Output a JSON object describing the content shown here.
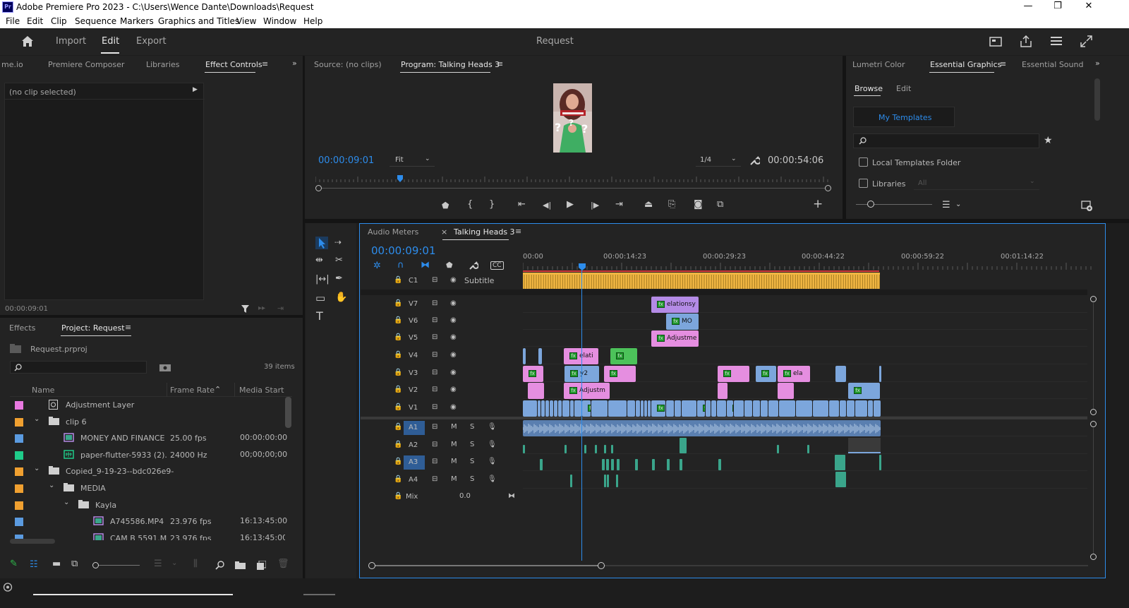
{
  "window": {
    "app_badge": "Pr",
    "title": "Adobe Premiere Pro 2023 - C:\\Users\\Wence Dante\\Downloads\\Request",
    "minimize": "—",
    "restore": "❐",
    "close": "✕"
  },
  "menu": [
    "File",
    "Edit",
    "Clip",
    "Sequence",
    "Markers",
    "Graphics and Titles",
    "View",
    "Window",
    "Help"
  ],
  "header": {
    "nav": [
      "Import",
      "Edit",
      "Export"
    ],
    "active": "Edit",
    "project_name": "Request"
  },
  "left_top": {
    "tabs": [
      "me.io",
      "Premiere Composer",
      "Libraries",
      "Effect Controls"
    ],
    "active_tab": "Effect Controls",
    "no_clip": "(no clip selected)",
    "timecode": "00:00:09:01"
  },
  "project": {
    "tabs": [
      "Effects",
      "Project: Request"
    ],
    "active_tab": "Project: Request",
    "file": "Request.prproj",
    "item_count": "39 items",
    "columns": [
      "Name",
      "Frame Rate",
      "Media Start"
    ],
    "rows": [
      {
        "name": "Adjustment Layer",
        "color": "#e879e0",
        "indent": 0,
        "type": "adjust",
        "frame_rate": "",
        "media_start": ""
      },
      {
        "name": "clip 6",
        "color": "#f0a030",
        "indent": 0,
        "type": "folder",
        "frame_rate": "",
        "media_start": ""
      },
      {
        "name": "MONEY AND FINANCE",
        "color": "#5b9be0",
        "indent": 1,
        "type": "sequence",
        "frame_rate": "25.00 fps",
        "media_start": "00:00:00:00"
      },
      {
        "name": "paper-flutter-5933 (2).",
        "color": "#1fcc8a",
        "indent": 1,
        "type": "audio",
        "frame_rate": "24000 Hz",
        "media_start": "00;00;00;00"
      },
      {
        "name": "Copied_9-19-23--bdc026e9-",
        "color": "#f0a030",
        "indent": 0,
        "type": "folder",
        "frame_rate": "",
        "media_start": ""
      },
      {
        "name": "MEDIA",
        "color": "#f0a030",
        "indent": 1,
        "type": "folder",
        "frame_rate": "",
        "media_start": ""
      },
      {
        "name": "Kayla",
        "color": "#f0a030",
        "indent": 2,
        "type": "folder",
        "frame_rate": "",
        "media_start": ""
      },
      {
        "name": "A745586.MP4",
        "color": "#5b9be0",
        "indent": 3,
        "type": "video",
        "frame_rate": "23.976 fps",
        "media_start": "16:13:45:00"
      },
      {
        "name": "CAM B 5591.M",
        "color": "#5b9be0",
        "indent": 3,
        "type": "video",
        "frame_rate": "23.976 fps",
        "media_start": "16:13:45:00"
      }
    ]
  },
  "monitor": {
    "tabs": [
      "Source: (no clips)",
      "Program: Talking Heads 3"
    ],
    "active_tab": "Program: Talking Heads 3",
    "timecode": "00:00:09:01",
    "fit": "Fit",
    "resolution": "1/4",
    "duration": "00:00:54:06",
    "playhead_pct": 0.255
  },
  "essential_graphics": {
    "tabs": [
      "Lumetri Color",
      "Essential Graphics",
      "Essential Sound"
    ],
    "active_tab": "Essential Graphics",
    "subtabs": [
      "Browse",
      "Edit"
    ],
    "active_subtab": "Browse",
    "templates_button": "My Templates",
    "local_templates": "Local Templates Folder",
    "libraries": "Libraries",
    "libraries_select": "All"
  },
  "timeline": {
    "tabs": [
      "Audio Meters",
      "Talking Heads 3"
    ],
    "active_tab": "Talking Heads 3",
    "timecode": "00:00:09:01",
    "ruler": [
      "00:00",
      "00:00:14:23",
      "00:00:29:23",
      "00:00:44:22",
      "00:00:59:22",
      "00:01:14:22"
    ],
    "caption_track": {
      "name": "C1",
      "label": "Subtitle"
    },
    "video_tracks": [
      "V7",
      "V6",
      "V5",
      "V4",
      "V3",
      "V2",
      "V1"
    ],
    "audio_tracks": [
      "A1",
      "A2",
      "A3",
      "A4"
    ],
    "highlighted_audio": [
      "A1",
      "A3"
    ],
    "mute_label": "M",
    "solo_label": "S",
    "mix_label": "Mix",
    "mix_value": "0.0",
    "clip_labels": {
      "v7": "elationsy",
      "v6": "MO",
      "v5": "Adjustme",
      "v4": "elati",
      "v3a": "y2",
      "v3b": "ela",
      "v2": "Adjustm"
    },
    "colors": {
      "pink": "#e58ee0",
      "purple": "#b48be6",
      "blue": "#7ca6dc",
      "green": "#4cc25a",
      "yellow": "#f0b542",
      "audio": "#3aa58b"
    }
  }
}
